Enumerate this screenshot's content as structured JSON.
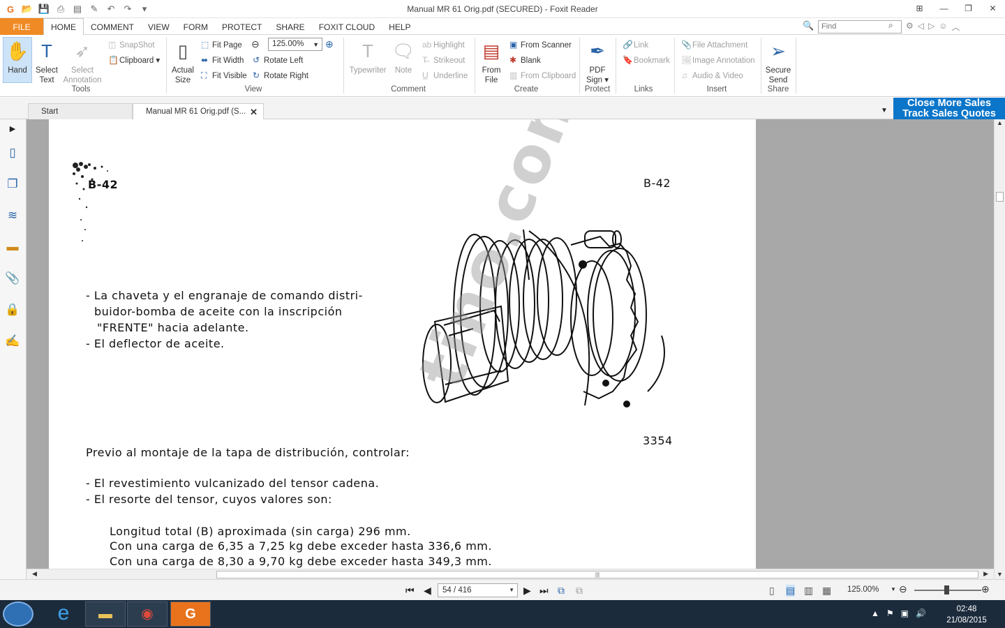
{
  "window": {
    "title": "Manual MR 61 Orig.pdf (SECURED) - Foxit Reader"
  },
  "menu": {
    "file": "FILE",
    "items": [
      "HOME",
      "COMMENT",
      "VIEW",
      "FORM",
      "PROTECT",
      "SHARE",
      "FOXIT CLOUD",
      "HELP"
    ],
    "active": "HOME"
  },
  "find": {
    "placeholder": "Find"
  },
  "ribbon": {
    "hand": "Hand",
    "select_text": [
      "Select",
      "Text"
    ],
    "select_annotation": [
      "Select",
      "Annotation"
    ],
    "snapshot": "SnapShot",
    "clipboard": "Clipboard",
    "tools_group": "Tools",
    "actual_size": [
      "Actual",
      "Size"
    ],
    "fit_page": "Fit Page",
    "fit_width": "Fit Width",
    "fit_visible": "Fit Visible",
    "zoom_value": "125.00%",
    "rotate_left": "Rotate Left",
    "rotate_right": "Rotate Right",
    "view_group": "View",
    "typewriter": "Typewriter",
    "note": "Note",
    "highlight": "Highlight",
    "strikeout": "Strikeout",
    "underline": "Underline",
    "comment_group": "Comment",
    "from_file": [
      "From",
      "File"
    ],
    "from_scanner": "From Scanner",
    "blank": "Blank",
    "from_clipboard": "From Clipboard",
    "create_group": "Create",
    "pdf_sign": [
      "PDF",
      "Sign"
    ],
    "protect_group": "Protect",
    "link": "Link",
    "bookmark": "Bookmark",
    "links_group": "Links",
    "file_attachment": "File Attachment",
    "image_annotation": "Image Annotation",
    "audio_video": "Audio & Video",
    "insert_group": "Insert",
    "secure_send": [
      "Secure",
      "Send"
    ],
    "share_group": "Share"
  },
  "tabs": {
    "start": "Start",
    "doc": "Manual MR 61 Orig.pdf (S..."
  },
  "ad": {
    "line1": "Close More Sales",
    "line2": "Track Sales Quotes"
  },
  "document": {
    "page_code_left": "B-42",
    "page_code_right": "B-42",
    "figure_number": "3354",
    "para1": [
      "- La chaveta y el engranaje de comando distri-",
      "buidor-bomba de aceite con la inscripción",
      "\"FRENTE\" hacia adelante.",
      "- El deflector de aceite."
    ],
    "heading": "Previo al montaje de la tapa de distribución, controlar:",
    "para2": [
      "- El revestimiento vulcanizado del tensor cadena.",
      "- El resorte del tensor, cuyos valores son:"
    ],
    "para3": [
      "Longitud total (B) aproximada (sin carga) 296 mm.",
      "Con una carga de 6,35 a 7,25 kg debe exceder hasta 336,6 mm.",
      "Con una carga de 8,30 a 9,70 kg debe exceder hasta 349,3 mm."
    ],
    "watermark": "tino.com.ar"
  },
  "status": {
    "page": "54 / 416",
    "zoom": "125.00%"
  },
  "clock": {
    "time": "02:48",
    "date": "21/08/2015"
  }
}
